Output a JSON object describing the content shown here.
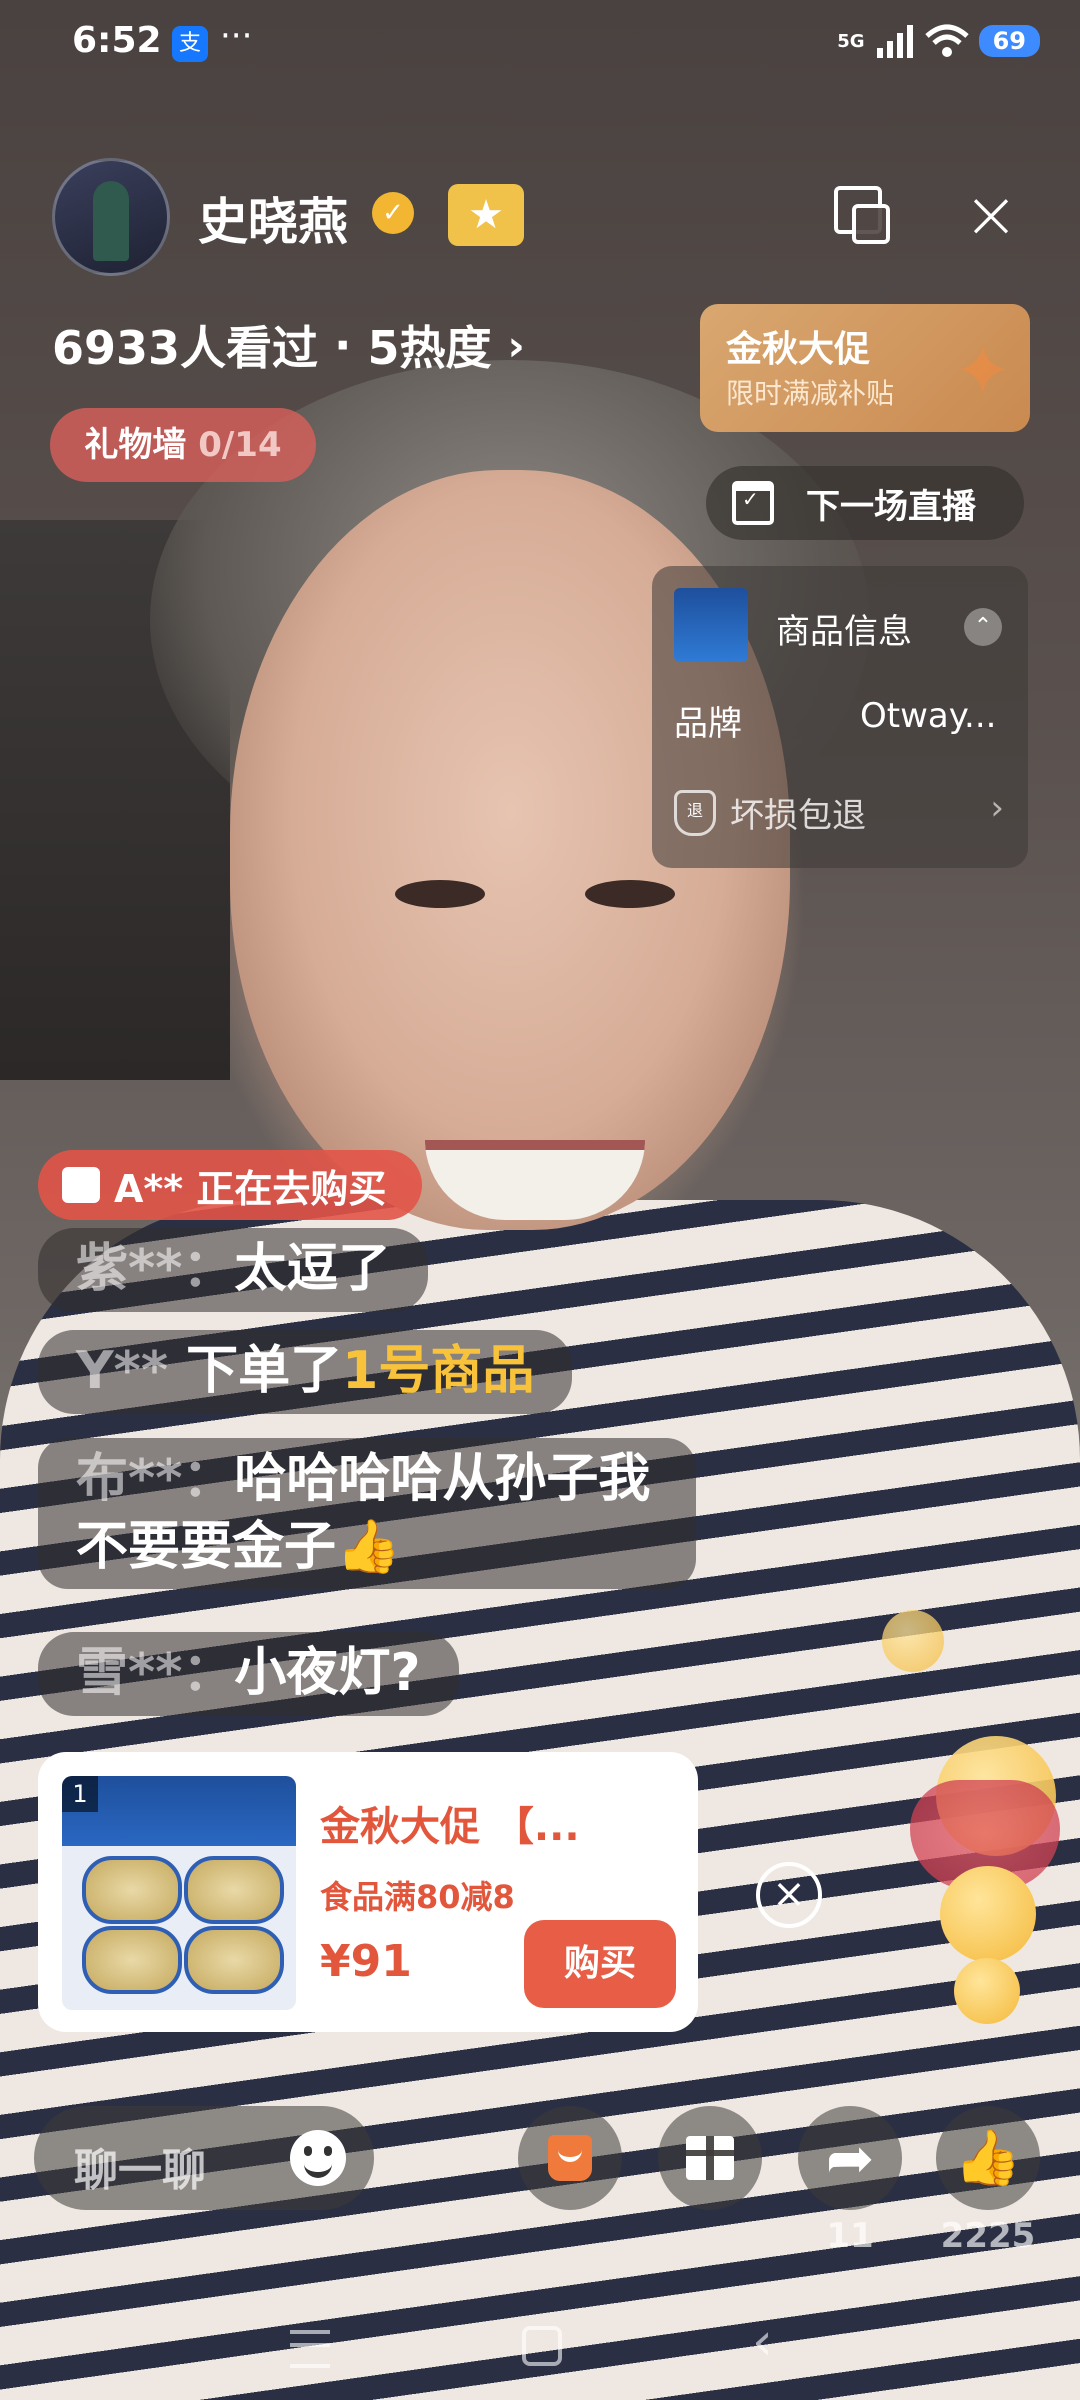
{
  "status_bar": {
    "time": "6:52",
    "app_icon_glyph": "支",
    "more": "···",
    "network": "5G",
    "battery": "69"
  },
  "host": {
    "name": "史晓燕",
    "verified_glyph": "✓",
    "badge_glyph": "★"
  },
  "stats": {
    "viewers": "6933人看过",
    "separator": "·",
    "heat": "5热度"
  },
  "gift_wall": {
    "label": "礼物墙 ",
    "count": "0/14"
  },
  "promo": {
    "title": "金秋大促",
    "subtitle": "限时满减补贴"
  },
  "next_live": {
    "label": "下一场直播"
  },
  "product_info": {
    "title": "商品信息",
    "brand_label": "品牌",
    "brand_value": "Otway...",
    "shield_glyph": "退",
    "guarantee": "坏损包退"
  },
  "comments": {
    "purchase_notice": "A** 正在去购买",
    "c1": {
      "user": "紫**：",
      "text": "太逗了"
    },
    "c2": {
      "user": "Y** ",
      "text": "下单了",
      "highlight": "1号商品"
    },
    "c3": {
      "user": "布**：",
      "text": "哈哈哈哈从孙子我不要要金子👍"
    },
    "c4": {
      "user": "雪**：",
      "text": "小夜灯?"
    }
  },
  "product_card": {
    "rank": "1",
    "title": "金秋大促 【...",
    "promo": "食品满80减8",
    "price": "¥91",
    "buy_label": "购买",
    "close_glyph": "×"
  },
  "bottom_bar": {
    "chat_placeholder": "聊一聊",
    "share_count": "11",
    "like_count": "2225"
  },
  "colors": {
    "accent": "#e85d45",
    "promo_gold": "#d9a770",
    "highlight_yellow": "#f8c33a",
    "gift_wall_red": "#d65f5a"
  }
}
